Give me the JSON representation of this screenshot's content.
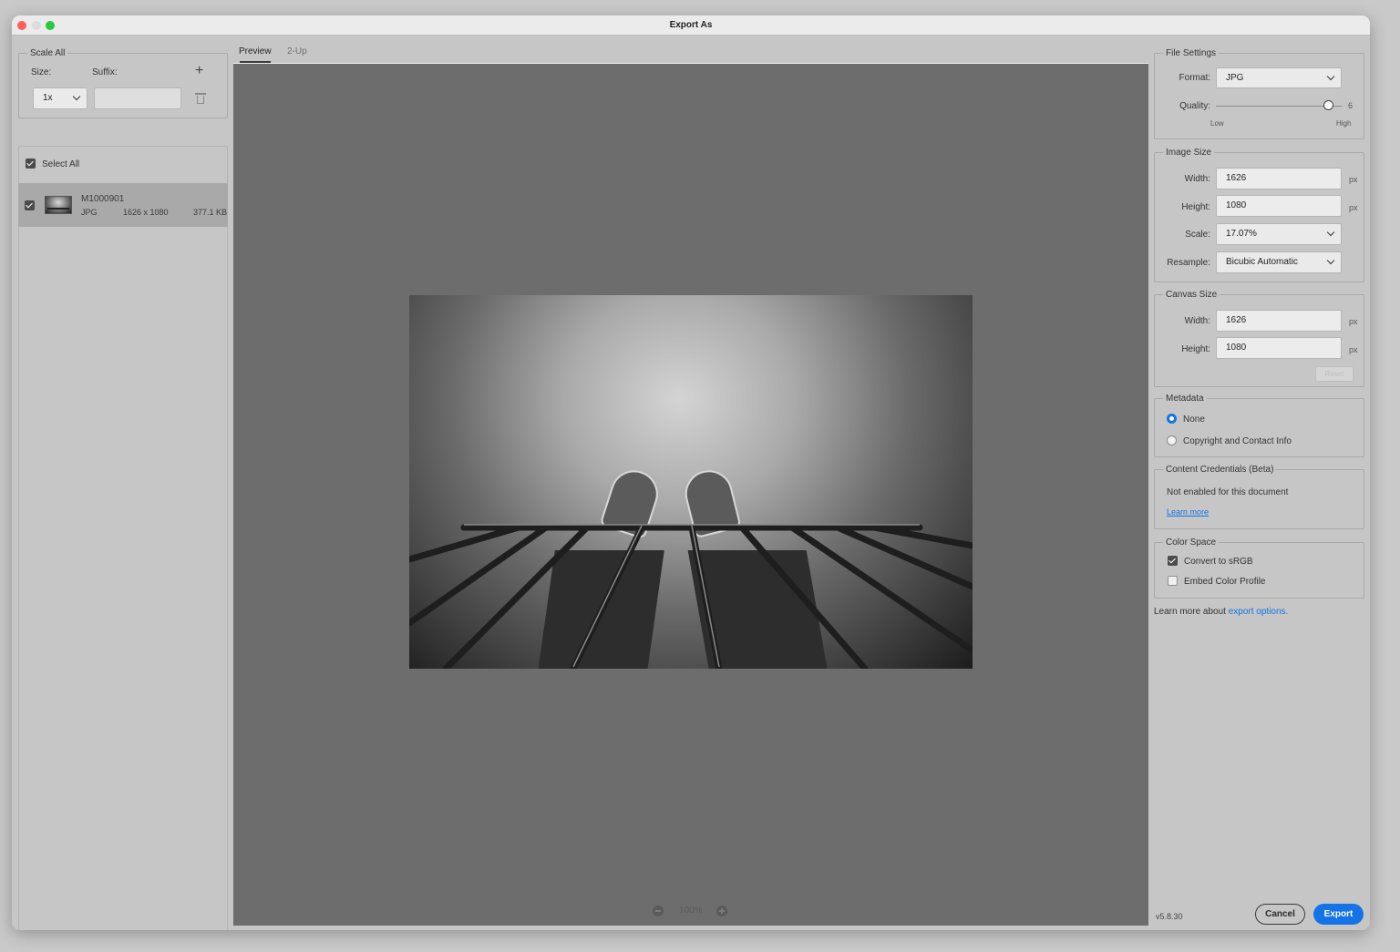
{
  "window": {
    "title": "Export As"
  },
  "scale_all": {
    "legend": "Scale All",
    "size_label": "Size:",
    "suffix_label": "Suffix:",
    "size_value": "1x",
    "suffix_value": "",
    "add_icon": "plus-icon",
    "delete_icon": "trash-icon"
  },
  "assets": {
    "select_all_label": "Select All",
    "select_all_checked": true,
    "items": [
      {
        "name": "M1000901",
        "format": "JPG",
        "dimensions": "1626 x 1080",
        "size": "377.1 KB",
        "checked": true
      }
    ]
  },
  "preview": {
    "tabs": [
      {
        "label": "Preview",
        "active": true
      },
      {
        "label": "2-Up",
        "active": false
      }
    ],
    "zoom_level": "100%"
  },
  "file_settings": {
    "legend": "File Settings",
    "format_label": "Format:",
    "format_value": "JPG",
    "quality_label": "Quality:",
    "quality_value": "6",
    "quality_fraction": 0.9,
    "low_label": "Low",
    "high_label": "High"
  },
  "image_size": {
    "legend": "Image Size",
    "width_label": "Width:",
    "width_value": "1626",
    "height_label": "Height:",
    "height_value": "1080",
    "scale_label": "Scale:",
    "scale_value": "17.07%",
    "resample_label": "Resample:",
    "resample_value": "Bicubic Automatic",
    "unit": "px"
  },
  "canvas_size": {
    "legend": "Canvas Size",
    "width_label": "Width:",
    "width_value": "1626",
    "height_label": "Height:",
    "height_value": "1080",
    "unit": "px",
    "reset_label": "Reset"
  },
  "metadata": {
    "legend": "Metadata",
    "options": [
      {
        "label": "None",
        "selected": true
      },
      {
        "label": "Copyright and Contact Info",
        "selected": false
      }
    ]
  },
  "content_credentials": {
    "legend": "Content Credentials (Beta)",
    "status": "Not enabled for this document",
    "learn_more": "Learn more"
  },
  "color_space": {
    "legend": "Color Space",
    "convert_label": "Convert to sRGB",
    "convert_checked": true,
    "embed_label": "Embed Color Profile",
    "embed_checked": false
  },
  "footer": {
    "learn_more_prefix": "Learn more about",
    "learn_more_link": "export options.",
    "version": "v5.8.30",
    "cancel_label": "Cancel",
    "export_label": "Export"
  },
  "colors": {
    "accent": "#1473e6",
    "canvas": "#6d6d6d",
    "panel": "#c6c6c6"
  }
}
